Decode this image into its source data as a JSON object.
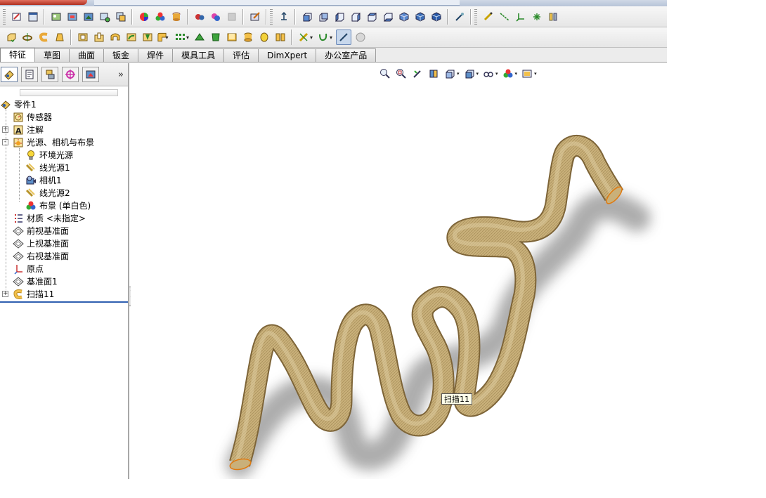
{
  "command_tabs": [
    "特征",
    "草图",
    "曲面",
    "钣金",
    "焊件",
    "模具工具",
    "评估",
    "DimXpert",
    "办公室产品"
  ],
  "active_tab": "特征",
  "feature_tree": {
    "root": "零件1",
    "items": [
      {
        "label": "传感器",
        "icon": "sensor-icon",
        "level": 1,
        "expander": ""
      },
      {
        "label": "注解",
        "icon": "annotation-icon",
        "level": 1,
        "expander": "+"
      },
      {
        "label": "光源、相机与布景",
        "icon": "lights-cameras-icon",
        "level": 1,
        "expander": "-"
      },
      {
        "label": "环境光源",
        "icon": "ambient-light-icon",
        "level": 2,
        "expander": ""
      },
      {
        "label": "线光源1",
        "icon": "directional-light-icon",
        "level": 2,
        "expander": ""
      },
      {
        "label": "相机1",
        "icon": "camera-icon",
        "level": 2,
        "expander": ""
      },
      {
        "label": "线光源2",
        "icon": "directional-light-icon",
        "level": 2,
        "expander": ""
      },
      {
        "label": "布景 (单白色)",
        "icon": "scene-icon",
        "level": 2,
        "expander": ""
      },
      {
        "label": "材质 <未指定>",
        "icon": "material-icon",
        "level": 1,
        "expander": ""
      },
      {
        "label": "前视基准面",
        "icon": "plane-icon",
        "level": 1,
        "expander": ""
      },
      {
        "label": "上视基准面",
        "icon": "plane-icon",
        "level": 1,
        "expander": ""
      },
      {
        "label": "右视基准面",
        "icon": "plane-icon",
        "level": 1,
        "expander": ""
      },
      {
        "label": "原点",
        "icon": "origin-icon",
        "level": 1,
        "expander": ""
      },
      {
        "label": "基准面1",
        "icon": "plane-icon",
        "level": 1,
        "expander": ""
      },
      {
        "label": "扫描11",
        "icon": "sweep-icon",
        "level": 1,
        "expander": "+"
      }
    ]
  },
  "panel_more": "»",
  "tooltip": "扫描11",
  "colors": {
    "rope": "#c9b07a",
    "rope_dark": "#8f7442",
    "end_cap": "#e07a10"
  }
}
